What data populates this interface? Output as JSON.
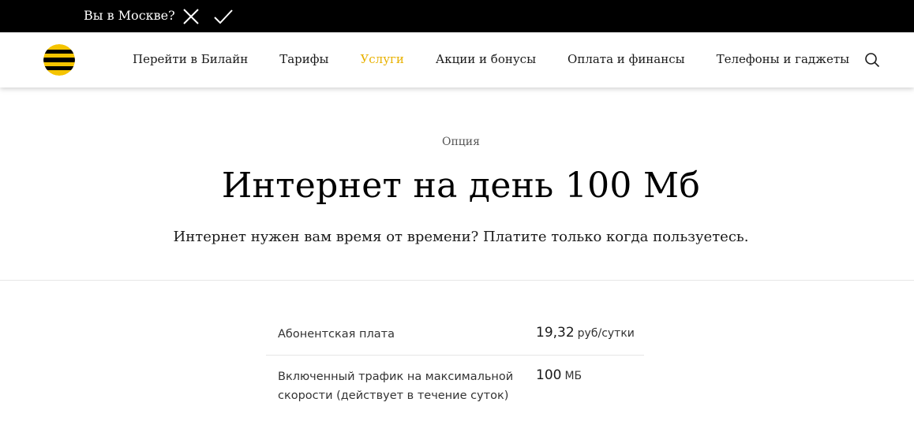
{
  "city_bar": {
    "question": "Вы в Москве?",
    "icons": {
      "no": "close-icon",
      "yes": "check-icon"
    }
  },
  "header": {
    "logo": "beeline-logo",
    "nav": [
      {
        "label": "Перейти в Билайн",
        "active": false
      },
      {
        "label": "Тарифы",
        "active": false
      },
      {
        "label": "Услуги",
        "active": true
      },
      {
        "label": "Акции и бонусы",
        "active": false
      },
      {
        "label": "Оплата и финансы",
        "active": false
      },
      {
        "label": "Телефоны и гаджеты",
        "active": false
      }
    ],
    "search_icon": "search-icon"
  },
  "hero": {
    "eyebrow": "Опция",
    "title": "Интернет на день 100 Мб",
    "subtitle": "Интернет нужен вам время от времени? Платите только когда пользуетесь."
  },
  "params": [
    {
      "label": "Абонентская плата",
      "value": "19,32",
      "unit": "руб/сутки"
    },
    {
      "label": "Включенный трафик на максимальной скорости (действует в течение суток)",
      "value": "100",
      "unit": "МБ"
    }
  ],
  "colors": {
    "accent": "#e8b100",
    "logo_yellow": "#f5c400",
    "logo_black": "#000000",
    "top_bar": "#000000"
  }
}
